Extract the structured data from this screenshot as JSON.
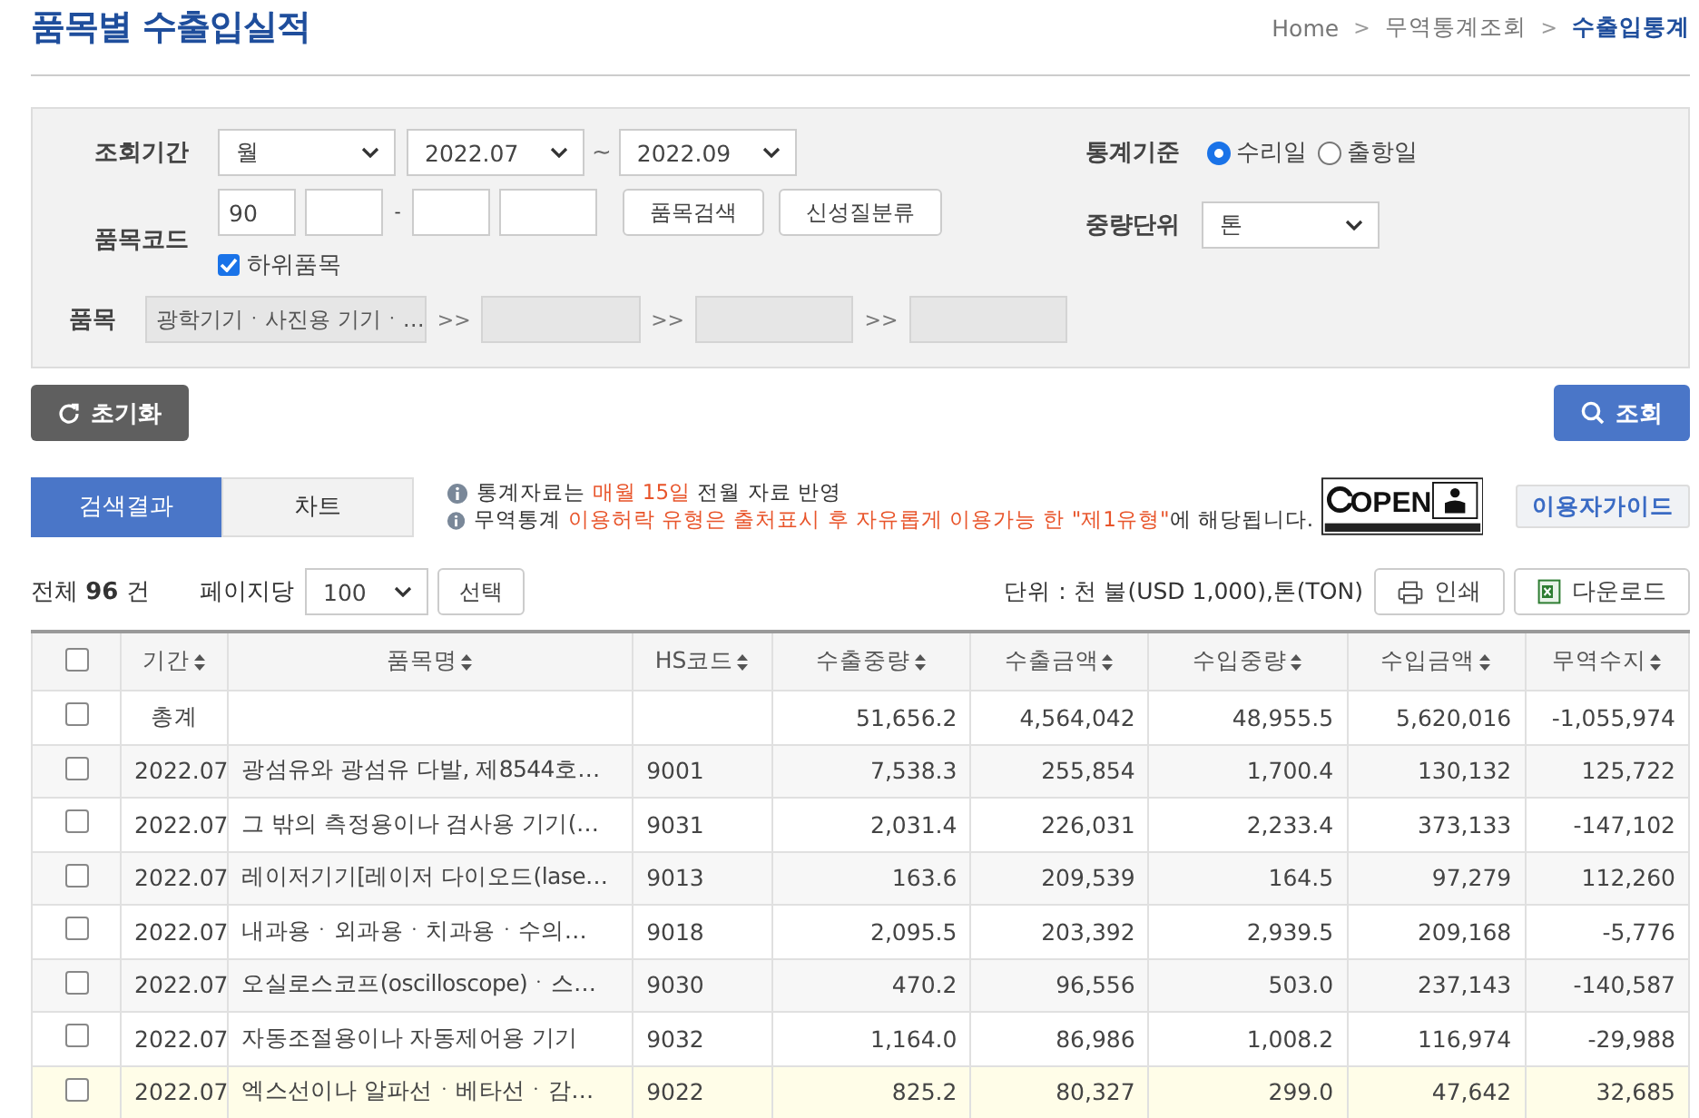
{
  "page_title": "품목별 수출입실적",
  "breadcrumb": [
    {
      "label": "Home",
      "selected": false
    },
    {
      "label": "무역통계조회",
      "selected": false
    },
    {
      "label": "수출입통계",
      "selected": true
    }
  ],
  "breadcrumb_separator": ">",
  "search": {
    "period": {
      "label": "조회기간",
      "unit": "월",
      "from": "2022.07",
      "tilde": "~",
      "to": "2022.09"
    },
    "basis": {
      "label": "통계기준",
      "options": [
        {
          "label": "수리일",
          "selected": true
        },
        {
          "label": "출항일",
          "selected": false
        }
      ]
    },
    "code": {
      "label": "품목코드",
      "parts": [
        "90"
      ],
      "dash": "-",
      "buttons": [
        "품목검색",
        "신성질분류"
      ],
      "sub_items": {
        "label": "하위품목",
        "checked": true
      }
    },
    "weight_unit": {
      "label": "중량단위",
      "value": "톤"
    },
    "item": {
      "label": "품목",
      "levels": [
        "광학기기ㆍ사진용 기기ㆍ…"
      ],
      "separator": ">>"
    }
  },
  "reset_button": "초기화",
  "query_button": "조회",
  "tabs": [
    {
      "label": "검색결과",
      "selected": true
    },
    {
      "label": "차트",
      "selected": false
    }
  ],
  "notices": [
    [
      {
        "text": "통계자료는 ",
        "highlight": false
      },
      {
        "text": "매월 15일",
        "highlight": true
      },
      {
        "text": " 전월 자료 반영",
        "highlight": false
      }
    ],
    [
      {
        "text": "무역통계 ",
        "highlight": false
      },
      {
        "text": "이용허락 유형은 출처표시 후 자유롭게 이용가능 한 \"제1유형\"",
        "highlight": true
      },
      {
        "text": "에 해당됩니다.",
        "highlight": false
      }
    ]
  ],
  "license_mark": "OPEN",
  "guide_button": "이용자가이드",
  "total": {
    "prefix": "전체",
    "count": "96",
    "suffix": "건"
  },
  "per_page": {
    "label": "페이지당",
    "value": "100",
    "button": "선택"
  },
  "unit_note": "단위 : 천 불(USD 1,000),톤(TON)",
  "print_button": "인쇄",
  "download_button": "다운로드",
  "table": {
    "select_all": {
      "checked": false
    },
    "columns": [
      {
        "label": "기간"
      },
      {
        "label": "품목명"
      },
      {
        "label": "HS코드"
      },
      {
        "label": "수출중량"
      },
      {
        "label": "수출금액"
      },
      {
        "label": "수입중량"
      },
      {
        "label": "수입금액"
      },
      {
        "label": "무역수지"
      }
    ],
    "rows": [
      {
        "checked": false,
        "highlighted": false,
        "cells": [
          "총계",
          "",
          "",
          "51,656.2",
          "4,564,042",
          "48,955.5",
          "5,620,016",
          "-1,055,974"
        ]
      },
      {
        "checked": false,
        "highlighted": false,
        "cells": [
          "2022.07",
          "광섬유와 광섬유 다발, 제8544호…",
          "9001",
          "7,538.3",
          "255,854",
          "1,700.4",
          "130,132",
          "125,722"
        ]
      },
      {
        "checked": false,
        "highlighted": false,
        "cells": [
          "2022.07",
          "그 밖의 측정용이나 검사용 기기(…",
          "9031",
          "2,031.4",
          "226,031",
          "2,233.4",
          "373,133",
          "-147,102"
        ]
      },
      {
        "checked": false,
        "highlighted": false,
        "cells": [
          "2022.07",
          "레이저기기[레이저 다이오드(lase…",
          "9013",
          "163.6",
          "209,539",
          "164.5",
          "97,279",
          "112,260"
        ]
      },
      {
        "checked": false,
        "highlighted": false,
        "cells": [
          "2022.07",
          "내과용ㆍ외과용ㆍ치과용ㆍ수의…",
          "9018",
          "2,095.5",
          "203,392",
          "2,939.5",
          "209,168",
          "-5,776"
        ]
      },
      {
        "checked": false,
        "highlighted": false,
        "cells": [
          "2022.07",
          "오실로스코프(oscilloscope)ㆍ스…",
          "9030",
          "470.2",
          "96,556",
          "503.0",
          "237,143",
          "-140,587"
        ]
      },
      {
        "checked": false,
        "highlighted": false,
        "cells": [
          "2022.07",
          "자동조절용이나 자동제어용 기기",
          "9032",
          "1,164.0",
          "86,986",
          "1,008.2",
          "116,974",
          "-29,988"
        ]
      },
      {
        "checked": false,
        "highlighted": true,
        "cells": [
          "2022.07",
          "엑스선이나 알파선ㆍ베타선ㆍ감…",
          "9022",
          "825.2",
          "80,327",
          "299.0",
          "47,642",
          "32,685"
        ]
      }
    ]
  }
}
